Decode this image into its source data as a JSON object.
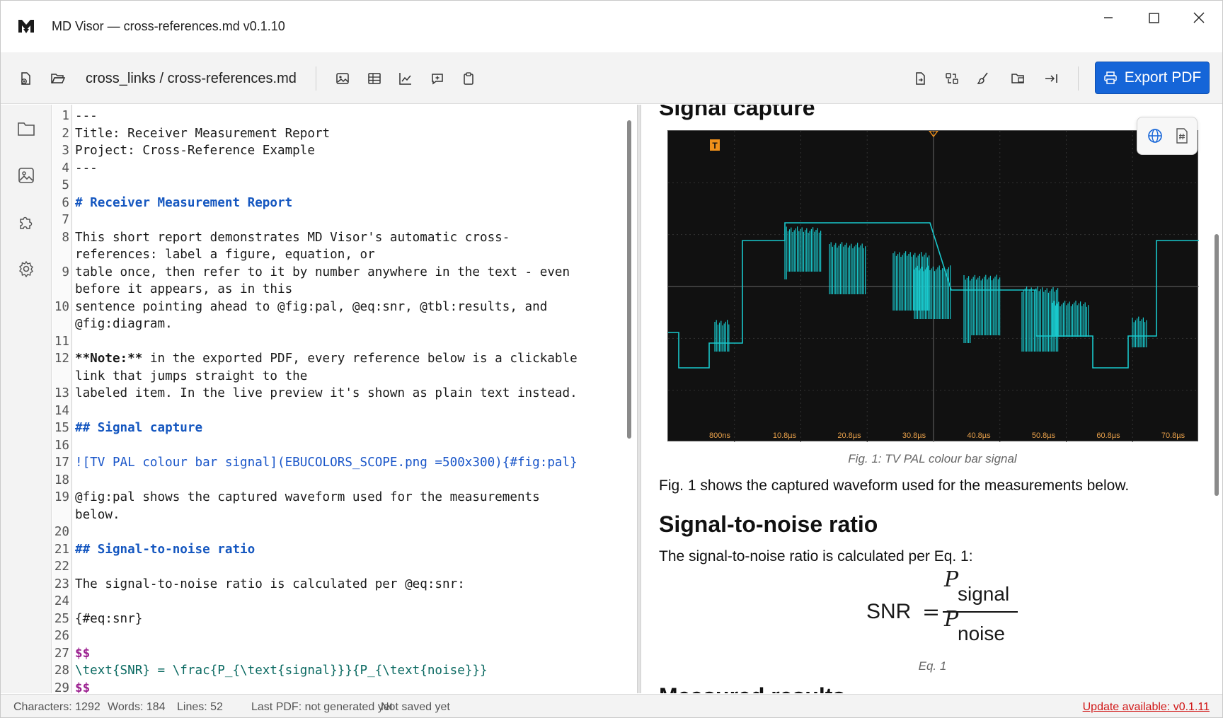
{
  "window": {
    "title": "MD Visor — cross-references.md v0.1.10"
  },
  "toolbar": {
    "path": "cross_links / cross-references.md",
    "export_label": "Export PDF"
  },
  "editor": {
    "lines": [
      {
        "n": "1",
        "t": "---"
      },
      {
        "n": "2",
        "t": "Title: Receiver Measurement Report"
      },
      {
        "n": "3",
        "t": "Project: Cross-Reference Example"
      },
      {
        "n": "4",
        "t": "---"
      },
      {
        "n": "5",
        "t": ""
      },
      {
        "n": "6",
        "t": "# Receiver Measurement Report",
        "style": "h"
      },
      {
        "n": "7",
        "t": ""
      },
      {
        "n": "8",
        "t": "This short report demonstrates MD Visor's automatic cross-"
      },
      {
        "n": "",
        "t": "references: label a figure, equation, or"
      },
      {
        "n": "9",
        "t": "table once, then refer to it by number anywhere in the text - even"
      },
      {
        "n": "",
        "t": "before it appears, as in this"
      },
      {
        "n": "10",
        "t": "sentence pointing ahead to @fig:pal, @eq:snr, @tbl:results, and"
      },
      {
        "n": "",
        "t": "@fig:diagram."
      },
      {
        "n": "11",
        "t": ""
      },
      {
        "n": "12",
        "t": "**Note:** in the exported PDF, every reference below is a clickable",
        "style": "note"
      },
      {
        "n": "",
        "t": "link that jumps straight to the"
      },
      {
        "n": "13",
        "t": "labeled item. In the live preview it's shown as plain text instead."
      },
      {
        "n": "14",
        "t": ""
      },
      {
        "n": "15",
        "t": "## Signal capture",
        "style": "h"
      },
      {
        "n": "16",
        "t": ""
      },
      {
        "n": "17",
        "t": "![TV PAL colour bar signal](EBUCOLORS_SCOPE.png =500x300){#fig:pal}",
        "style": "link"
      },
      {
        "n": "18",
        "t": ""
      },
      {
        "n": "19",
        "t": "@fig:pal shows the captured waveform used for the measurements"
      },
      {
        "n": "",
        "t": "below."
      },
      {
        "n": "20",
        "t": ""
      },
      {
        "n": "21",
        "t": "## Signal-to-noise ratio",
        "style": "h"
      },
      {
        "n": "22",
        "t": ""
      },
      {
        "n": "23",
        "t": "The signal-to-noise ratio is calculated per @eq:snr:"
      },
      {
        "n": "24",
        "t": ""
      },
      {
        "n": "25",
        "t": "{#eq:snr}"
      },
      {
        "n": "26",
        "t": ""
      },
      {
        "n": "27",
        "t": "$$",
        "style": "mathd"
      },
      {
        "n": "28",
        "t": "\\text{SNR} = \\frac{P_{\\text{signal}}}{P_{\\text{noise}}}",
        "style": "math"
      },
      {
        "n": "29",
        "t": "$$",
        "style": "mathd"
      }
    ]
  },
  "preview": {
    "h_signal_capture": "Signal capture",
    "scope_x_ticks": [
      "800ns",
      "10.8µs",
      "20.8µs",
      "30.8µs",
      "40.8µs",
      "50.8µs",
      "60.8µs",
      "70.8µs"
    ],
    "trigger_marker": "T",
    "fig_caption": "Fig. 1: TV PAL colour bar signal",
    "p_fig": "Fig. 1 shows the captured waveform used for the measurements below.",
    "h_snr": "Signal-to-noise ratio",
    "p_snr": "The signal-to-noise ratio is calculated per Eq. 1:",
    "eq_lhs": "SNR",
    "eq_num_p": "P",
    "eq_num_sub": "signal",
    "eq_den_p": "P",
    "eq_den_sub": "noise",
    "eq_caption": "Eq. 1",
    "h_next_partial": "Measured results"
  },
  "status": {
    "characters": "Characters: 1292",
    "words": "Words: 184",
    "lines": "Lines: 52",
    "last_pdf": "Last PDF: not generated yet",
    "saved": "Not saved yet",
    "update": "Update available: v0.1.11"
  },
  "colors": {
    "accent": "#1565d8",
    "waveform": "#19c8cc",
    "update_link": "#d01515"
  }
}
